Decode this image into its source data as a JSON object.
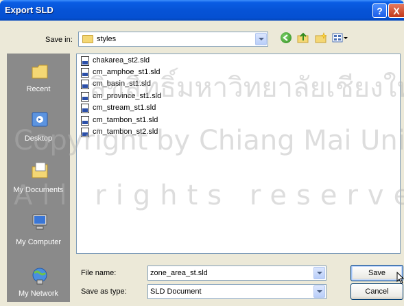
{
  "dialog": {
    "title": "Export SLD",
    "help_label": "?",
    "close_label": "X"
  },
  "save_in": {
    "label": "Save in:",
    "value": "styles"
  },
  "toolbar": {
    "icons": [
      "back-icon",
      "up-folder-icon",
      "new-folder-icon",
      "views-menu-icon"
    ]
  },
  "places": [
    {
      "label": "Recent",
      "icon": "recent-folder-icon"
    },
    {
      "label": "Desktop",
      "icon": "desktop-icon"
    },
    {
      "label": "My Documents",
      "icon": "my-documents-icon"
    },
    {
      "label": "My Computer",
      "icon": "my-computer-icon"
    },
    {
      "label": "My Network",
      "icon": "my-network-icon"
    }
  ],
  "files": [
    "chakarea_st2.sld",
    "cm_amphoe_st1.sld",
    "cm_basin_st1.sld",
    "cm_province_st1.sld",
    "cm_stream_st1.sld",
    "cm_tambon_st1.sld",
    "cm_tambon_st2.sld"
  ],
  "file_name": {
    "label": "File name:",
    "value": "zone_area_st.sld"
  },
  "save_as_type": {
    "label": "Save as type:",
    "value": "SLD Document"
  },
  "buttons": {
    "save": "Save",
    "cancel": "Cancel"
  },
  "watermark": {
    "line1": "ลิขสิทธิ์มหาวิทยาลัยเชียงใหม่",
    "line2": "Copyright by Chiang Mai University",
    "line3": "All rights reserved"
  }
}
